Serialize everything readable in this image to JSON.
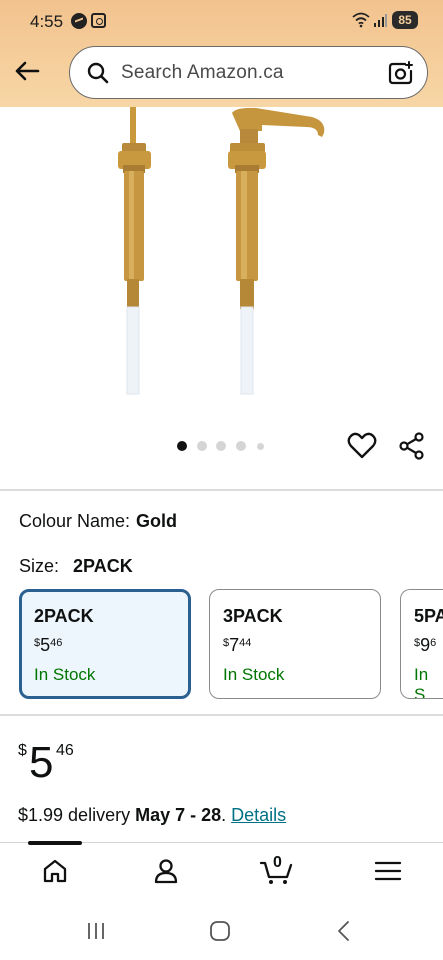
{
  "status_bar": {
    "time": "4:55",
    "battery": "85"
  },
  "search": {
    "placeholder": "Search Amazon.ca"
  },
  "gallery": {
    "image_count": 5,
    "active_index": 0
  },
  "colour": {
    "label": "Colour Name:",
    "value": "Gold"
  },
  "size": {
    "label": "Size:",
    "value": "2PACK",
    "options": [
      {
        "name": "2PACK",
        "currency": "$",
        "dollars": "5",
        "cents": "46",
        "stock": "In Stock",
        "selected": true
      },
      {
        "name": "3PACK",
        "currency": "$",
        "dollars": "7",
        "cents": "44",
        "stock": "In Stock",
        "selected": false
      },
      {
        "name": "5PA",
        "currency": "$",
        "dollars": "9",
        "cents": "6",
        "stock": "In S",
        "selected": false
      }
    ]
  },
  "price": {
    "currency": "$",
    "dollars": "5",
    "cents": "46"
  },
  "delivery": {
    "prefix": "$1.99 delivery ",
    "dates": "May 7 - 28",
    "separator": ". ",
    "details_link": "Details"
  },
  "bottom_nav": {
    "cart_count": "0",
    "items": [
      "home",
      "account",
      "cart",
      "menu"
    ]
  },
  "colors": {
    "header_top": "#f2c28e",
    "selected_border": "#2a6191",
    "in_stock": "#007600",
    "link": "#007185",
    "gold": "#c89a3c"
  }
}
